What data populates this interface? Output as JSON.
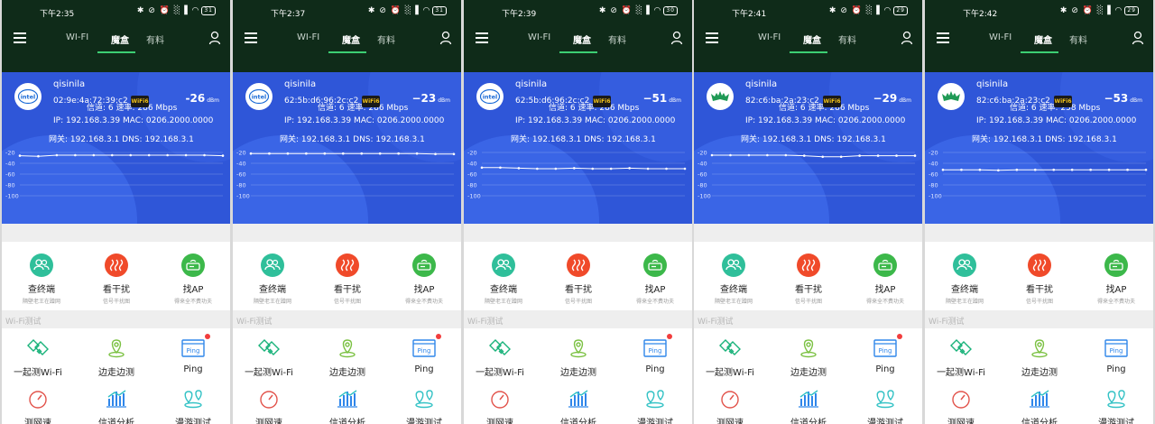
{
  "header": {
    "tabs": [
      "WI-FI",
      "魔盒",
      "有料"
    ]
  },
  "status_icons": "✱ ⊘ ⏰ ░▐ ◠",
  "sections": {
    "wifi_test": "Wi-Fi测试"
  },
  "features": [
    {
      "name": "查终端",
      "sub": "隔壁老王在蹭网",
      "color": "#2fbf9a",
      "icon": "users-icon"
    },
    {
      "name": "看干扰",
      "sub": "信号干扰图",
      "color": "#f04a2a",
      "icon": "heat-icon"
    },
    {
      "name": "找AP",
      "sub": "得来全不费功夫",
      "color": "#3cb84a",
      "icon": "router-icon"
    }
  ],
  "tools": [
    {
      "name": "一起测Wi-Fi",
      "icon": "handshake-icon"
    },
    {
      "name": "边走边测",
      "icon": "location-pin-icon"
    },
    {
      "name": "Ping",
      "icon": "ping-icon",
      "icon_text": "Ping"
    },
    {
      "name": "测网速",
      "icon": "speedometer-icon"
    },
    {
      "name": "信道分析",
      "icon": "bar-chart-icon"
    },
    {
      "name": "漫游测试",
      "icon": "roaming-pins-icon"
    }
  ],
  "y_axis_ticks": [
    "-20",
    "-40",
    "-60",
    "-80",
    "-100"
  ],
  "colors": {
    "header": "#0f2b19",
    "panel": "#2f56d8",
    "accent": "#3ccf73",
    "tool_icon": "#19b27a",
    "tool_icon_blue": "#2f86ea"
  },
  "screens": [
    {
      "time": "下午2:35",
      "battery": "31",
      "ssid": "qisinila",
      "mac": "02:9e:4a:72:39:c2",
      "rate": "信道: 6  速率: 286 Mbps",
      "signal": "-26",
      "signal_unit": "dBm",
      "ip_line": "IP: 192.168.3.39  MAC: 0206.2000.0000",
      "gw_line": "网关: 192.168.3.1  DNS: 192.168.3.1",
      "logo": "intel",
      "logo_text": "intel",
      "wifi6_badge": "WiFi6",
      "ping_dot": true,
      "chart_data": {
        "type": "line",
        "ylim": [
          -100,
          -20
        ],
        "values": [
          -26,
          -27,
          -25,
          -25,
          -25,
          -25,
          -25,
          -25,
          -25,
          -25,
          -25,
          -26
        ]
      }
    },
    {
      "time": "下午2:37",
      "battery": "31",
      "ssid": "qisinila",
      "mac": "62:5b:d6:96:2c:c2",
      "rate": "信道: 6  速率: 286 Mbps",
      "signal": "−23",
      "signal_unit": "dBm",
      "ip_line": "IP: 192.168.3.39  MAC: 0206.2000.0000",
      "gw_line": "网关: 192.168.3.1  DNS: 192.168.3.1",
      "logo": "intel",
      "logo_text": "intel",
      "wifi6_badge": "WiFi6",
      "ping_dot": true,
      "chart_data": {
        "type": "line",
        "ylim": [
          -100,
          -20
        ],
        "values": [
          -22,
          -22,
          -22,
          -22,
          -22,
          -22,
          -22,
          -22,
          -22,
          -22,
          -23,
          -23
        ]
      }
    },
    {
      "time": "下午2:39",
      "battery": "30",
      "ssid": "qisinila",
      "mac": "62:5b:d6:96:2c:c2",
      "rate": "信道: 6  速率: 286 Mbps",
      "signal": "−51",
      "signal_unit": "dBm",
      "ip_line": "IP: 192.168.3.39  MAC: 0206.2000.0000",
      "gw_line": "网关: 192.168.3.1  DNS: 192.168.3.1",
      "logo": "intel",
      "logo_text": "intel",
      "wifi6_badge": "WiFi6",
      "ping_dot": true,
      "chart_data": {
        "type": "line",
        "ylim": [
          -100,
          -20
        ],
        "values": [
          -48,
          -48,
          -49,
          -50,
          -50,
          -49,
          -50,
          -50,
          -49,
          -50,
          -50,
          -50
        ]
      }
    },
    {
      "time": "下午2:41",
      "battery": "29",
      "ssid": "qisinila",
      "mac": "82:c6:ba:2a:23:c2",
      "rate": "信道: 6  速率: 286 Mbps",
      "signal": "−29",
      "signal_unit": "dBm",
      "ip_line": "IP: 192.168.3.39  MAC: 0206.2000.0000",
      "gw_line": "网关: 192.168.3.1  DNS: 192.168.3.1",
      "logo": "bat",
      "logo_text": "",
      "wifi6_badge": "WiFi6",
      "ping_dot": true,
      "chart_data": {
        "type": "line",
        "ylim": [
          -100,
          -20
        ],
        "values": [
          -25,
          -25,
          -25,
          -25,
          -25,
          -26,
          -28,
          -28,
          -26,
          -26,
          -26,
          -26
        ]
      }
    },
    {
      "time": "下午2:42",
      "battery": "29",
      "ssid": "qisinila",
      "mac": "82:c6:ba:2a:23:c2",
      "rate": "信道: 6  速率: 258 Mbps",
      "signal": "−53",
      "signal_unit": "dBm",
      "ip_line": "IP: 192.168.3.39  MAC: 0206.2000.0000",
      "gw_line": "网关: 192.168.3.1  DNS: 192.168.3.1",
      "logo": "bat",
      "logo_text": "",
      "wifi6_badge": "WiFi6",
      "ping_dot": false,
      "chart_data": {
        "type": "line",
        "ylim": [
          -100,
          -20
        ],
        "values": [
          -52,
          -52,
          -52,
          -53,
          -52,
          -52,
          -52,
          -52,
          -52,
          -52,
          -52,
          -52
        ]
      }
    }
  ]
}
